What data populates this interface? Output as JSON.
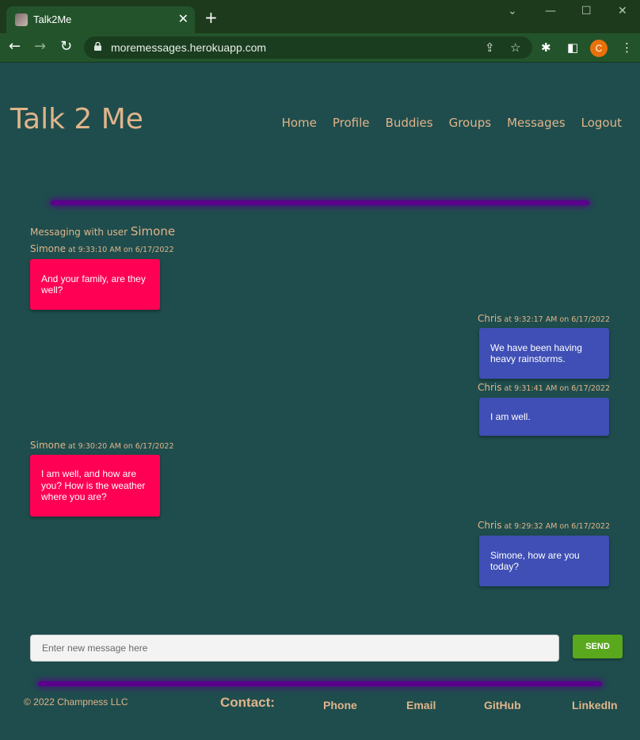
{
  "browser": {
    "tab_title": "Talk2Me",
    "tab_close": "✕",
    "new_tab": "+",
    "url": "moremessages.herokuapp.com",
    "profile_initial": "C"
  },
  "header": {
    "brand": "Talk 2 Me",
    "nav": [
      "Home",
      "Profile",
      "Buddies",
      "Groups",
      "Messages",
      "Logout"
    ]
  },
  "conversation": {
    "prefix": "Messaging with user ",
    "user": "Simone",
    "messages": [
      {
        "sender": "Simone",
        "time": " at 9:33:10 AM on 6/17/2022",
        "text": "And your family, are they well?",
        "direction": "in"
      },
      {
        "sender": "Chris",
        "time": " at 9:32:17 AM on 6/17/2022",
        "text": "We have been having heavy rainstorms.",
        "direction": "out"
      },
      {
        "sender": "Chris",
        "time": " at 9:31:41 AM on 6/17/2022",
        "text": "I am well.",
        "direction": "out"
      },
      {
        "sender": "Simone",
        "time": " at 9:30:20 AM on 6/17/2022",
        "text": "I am well, and how are you?  How is the weather where you are?",
        "direction": "in"
      },
      {
        "sender": "Chris",
        "time": " at 9:29:32 AM on 6/17/2022",
        "text": "Simone, how are you today?",
        "direction": "out"
      }
    ]
  },
  "composer": {
    "placeholder": "Enter new message here",
    "value": "",
    "send_label": "SEND"
  },
  "footer": {
    "copyright": "© 2022 Champness LLC",
    "contact_label": "Contact:",
    "links": [
      "Phone",
      "Email",
      "GitHub",
      "LinkedIn"
    ]
  },
  "colors": {
    "background": "#1f4d4d",
    "accent_text": "#e0b48a",
    "incoming_bubble": "#ff0055",
    "outgoing_bubble": "#3f4fb5",
    "divider": "#5a008c",
    "send_button": "#5aa81d"
  },
  "icons": [
    "back-icon",
    "forward-icon",
    "reload-icon",
    "lock-icon",
    "share-icon",
    "star-icon",
    "extensions-icon",
    "sidepanel-icon",
    "menu-icon"
  ]
}
